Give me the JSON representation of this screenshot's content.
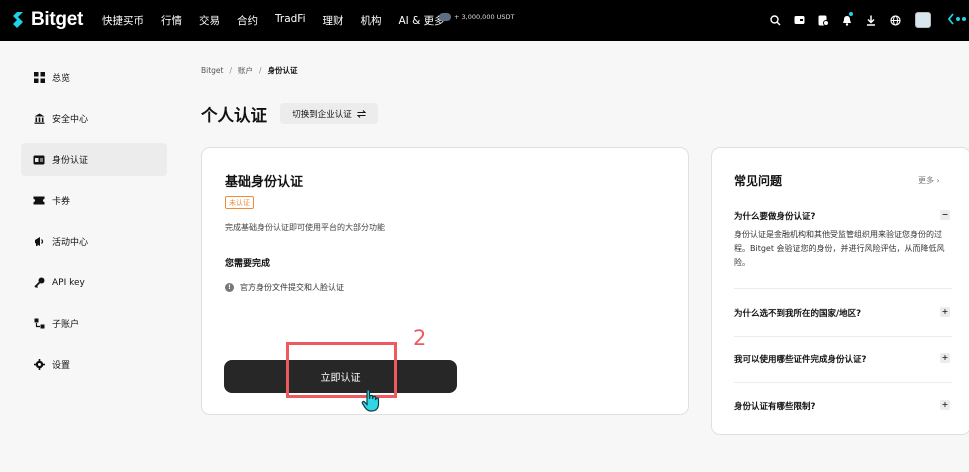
{
  "topbar": {
    "brand": "Bitget",
    "nav": [
      "快捷买币",
      "行情",
      "交易",
      "合约",
      "TradFi",
      "理财",
      "机构",
      "AI & 更多"
    ],
    "promo_text": "+ 3,000,000 USDT",
    "icons": [
      "search-icon",
      "wallet-icon",
      "assets-icon",
      "bell-icon",
      "download-icon",
      "globe-icon"
    ]
  },
  "sidebar": {
    "items": [
      {
        "label": "总览",
        "icon": "grid-icon"
      },
      {
        "label": "安全中心",
        "icon": "bank-icon"
      },
      {
        "label": "身份认证",
        "icon": "id-card-icon",
        "active": true
      },
      {
        "label": "卡券",
        "icon": "ticket-icon"
      },
      {
        "label": "活动中心",
        "icon": "megaphone-icon"
      },
      {
        "label": "API key",
        "icon": "key-icon"
      },
      {
        "label": "子账户",
        "icon": "subaccount-icon"
      },
      {
        "label": "设置",
        "icon": "gear-icon"
      }
    ]
  },
  "breadcrumb": {
    "items": [
      "Bitget",
      "账户",
      "身份认证"
    ]
  },
  "page": {
    "title": "个人认证",
    "switch_label": "切换到企业认证"
  },
  "verify_card": {
    "title": "基础身份认证",
    "status": "未认证",
    "description": "完成基础身份认证即可使用平台的大部分功能",
    "need_title": "您需要完成",
    "requirement": "官方身份文件提交和人脸认证",
    "button_label": "立即认证"
  },
  "annotation": {
    "number": "2",
    "color": "#ee5a5d"
  },
  "faq": {
    "title": "常见问题",
    "more": "更多",
    "items": [
      {
        "q": "为什么要做身份认证?",
        "a": "身份认证是金融机构和其他受监管组织用来验证您身份的过程。Bitget 会验证您的身份，并进行风险评估，从而降低风险。",
        "expanded": true
      },
      {
        "q": "为什么选不到我所在的国家/地区?"
      },
      {
        "q": "我可以使用哪些证件完成身份认证?"
      },
      {
        "q": "身份认证有哪些限制?"
      }
    ]
  },
  "colors": {
    "accent": "#1ed3e3",
    "warning": "#ed8d3a",
    "annotation": "#ee5a5d",
    "button": "#272727"
  }
}
